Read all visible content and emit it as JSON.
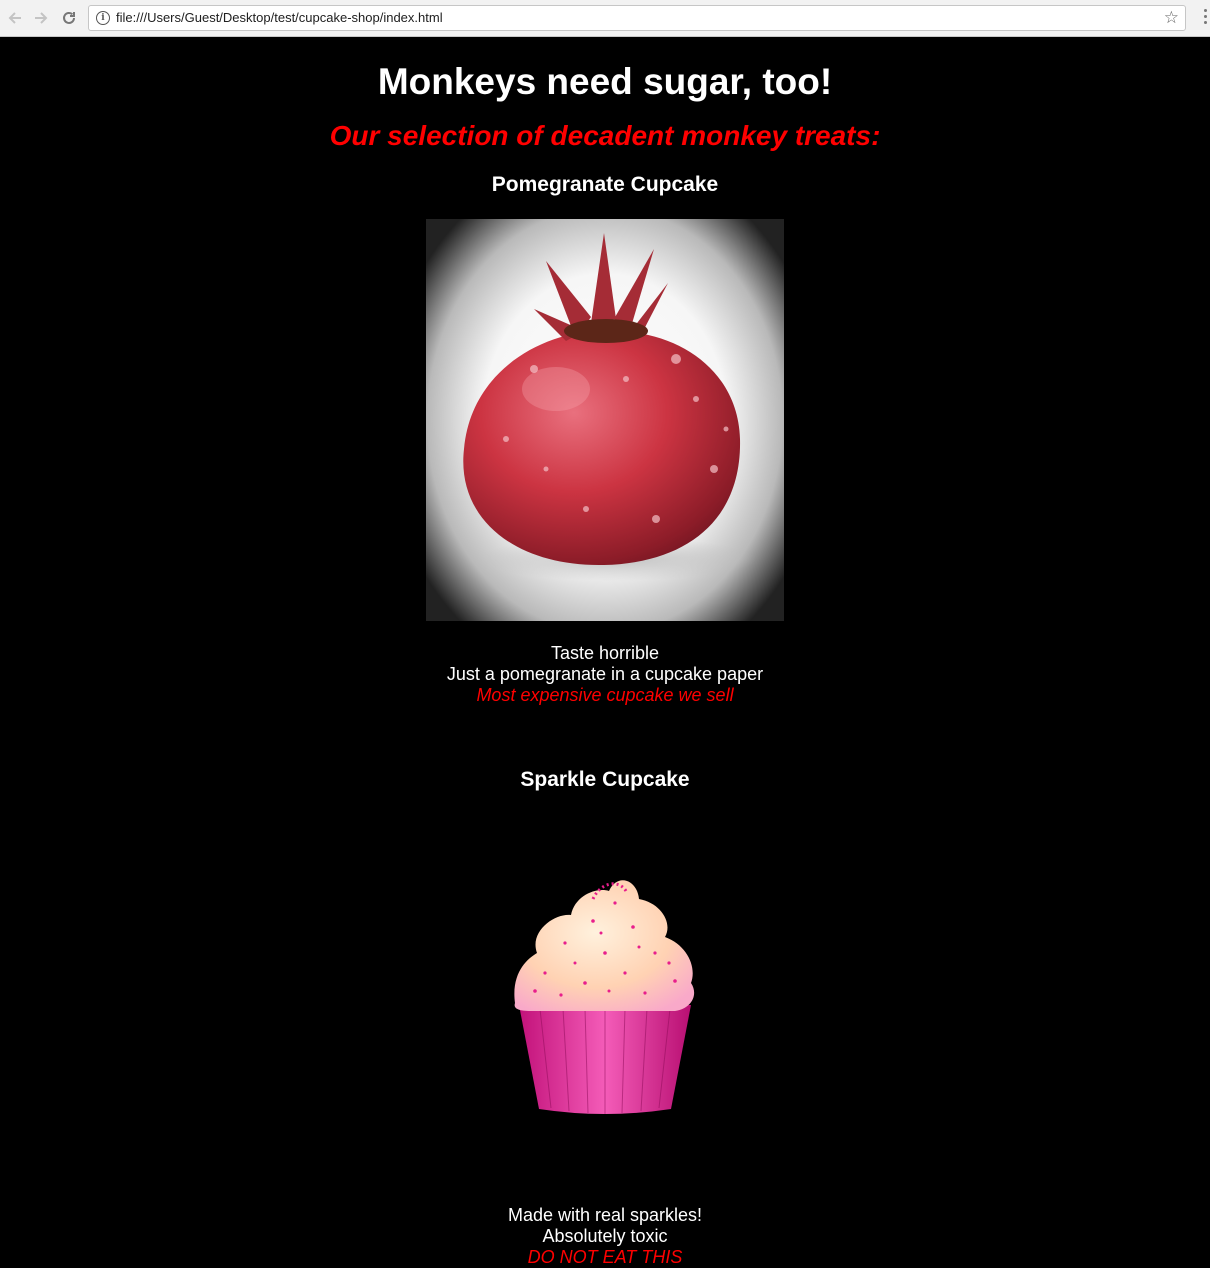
{
  "browser": {
    "url": "file:///Users/Guest/Desktop/test/cupcake-shop/index.html",
    "back_icon": "back-arrow-icon",
    "forward_icon": "forward-arrow-icon",
    "reload_icon": "reload-icon",
    "info_icon": "info-icon",
    "bookmark_icon": "star-icon",
    "menu_icon": "menu-dots-icon"
  },
  "page": {
    "heading": "Monkeys need sugar, too!",
    "subheading": "Our selection of decadent monkey treats:",
    "colors": {
      "background": "#000000",
      "text": "#ffffff",
      "accent": "#ff0000"
    }
  },
  "products": [
    {
      "title": "Pomegranate Cupcake",
      "lines": [
        "Taste horrible",
        "Just a pomegranate in a cupcake paper"
      ],
      "warning": "Most expensive cupcake we sell"
    },
    {
      "title": "Sparkle Cupcake",
      "lines": [
        "Made with real sparkles!",
        "Absolutely toxic"
      ],
      "warning": "DO NOT EAT THIS"
    }
  ]
}
